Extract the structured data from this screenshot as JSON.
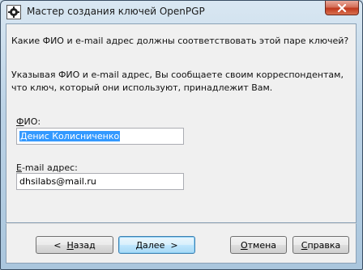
{
  "window": {
    "title": "Мастер создания ключей OpenPGP"
  },
  "content": {
    "question": "Какие ФИО и e-mail адрес должны соответствовать этой паре ключей?",
    "info_line1": "Указывая ФИО и e-mail адрес, Вы сообщаете своим корреспондентам,",
    "info_line2": "что ключ, который они используют, принадлежит Вам."
  },
  "form": {
    "name_label_accel": "Ф",
    "name_label_rest": "ИО:",
    "name_value": "Денис Колисниченко",
    "email_label_accel": "E",
    "email_label_rest": "-mail адрес:",
    "email_value": "dhsilabs@mail.ru"
  },
  "buttons": {
    "back_arrow": "<",
    "back_accel": "Н",
    "back_rest": "азад",
    "next_accel": "Д",
    "next_rest": "алее",
    "next_arrow": ">",
    "cancel_accel": "О",
    "cancel_rest": "тмена",
    "help_accel": "С",
    "help_rest": "правка"
  },
  "icons": {
    "app": "pgp-key-icon",
    "close": "close-icon"
  },
  "colors": {
    "selection": "#3399ff",
    "close_button": "#c0391e"
  }
}
